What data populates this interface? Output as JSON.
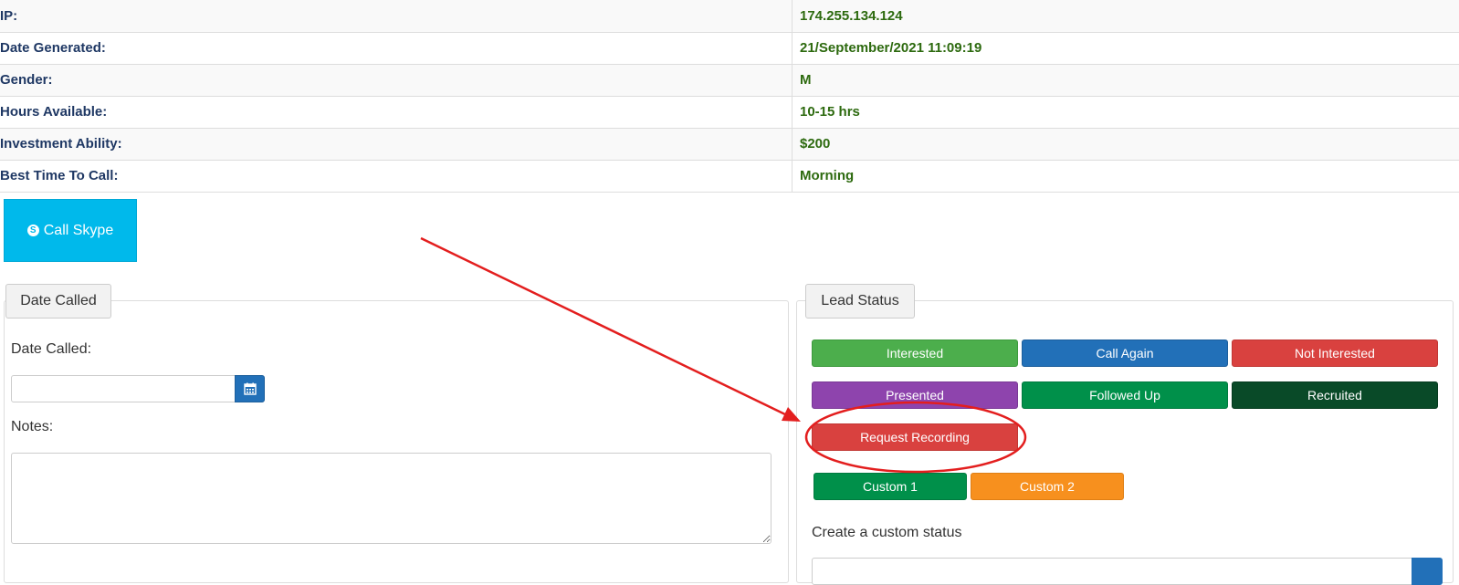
{
  "info": {
    "rows": [
      {
        "key": "IP:",
        "value": "174.255.134.124"
      },
      {
        "key": "Date Generated:",
        "value": "21/September/2021 11:09:19"
      },
      {
        "key": "Gender:",
        "value": "M"
      },
      {
        "key": "Hours Available:",
        "value": "10-15 hrs"
      },
      {
        "key": "Investment Ability:",
        "value": "$200"
      },
      {
        "key": "Best Time To Call:",
        "value": "Morning"
      }
    ]
  },
  "skype": {
    "label": "Call Skype",
    "icon": "skype-icon",
    "icon_glyph": "S",
    "color": "#00b9eb"
  },
  "date_panel": {
    "legend": "Date Called",
    "date_label": "Date Called:",
    "date_value": "",
    "calendar_icon": "calendar-icon",
    "notes_label": "Notes:",
    "notes_value": ""
  },
  "lead_panel": {
    "legend": "Lead Status",
    "statuses": [
      {
        "label": "Interested",
        "color": "#4cae4c"
      },
      {
        "label": "Call Again",
        "color": "#2270b8"
      },
      {
        "label": "Not Interested",
        "color": "#d9413f"
      },
      {
        "label": "Presented",
        "color": "#8e44ad"
      },
      {
        "label": "Followed Up",
        "color": "#00904a"
      },
      {
        "label": "Recruited",
        "color": "#094a28"
      },
      {
        "label": "Request Recording",
        "color": "#d9413f"
      }
    ],
    "custom_statuses": [
      {
        "label": "Custom 1",
        "color": "#00904a"
      },
      {
        "label": "Custom 2",
        "color": "#f7901e"
      }
    ],
    "create_custom_label": "Create a custom status",
    "custom_input_value": ""
  },
  "annotation": {
    "color": "#e31e1e",
    "arrow_icon": "red-arrow",
    "highlight_icon": "red-ellipse"
  }
}
